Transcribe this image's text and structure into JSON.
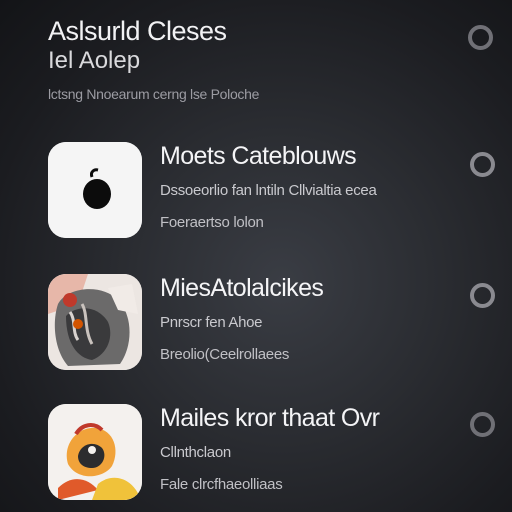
{
  "header": {
    "title": "Aslsurld Cleses",
    "subtitle": "Iel Aolep",
    "description": "lctsng Nnoearum cerng  lse  Poloche"
  },
  "items": [
    {
      "title": "Moets Cateblouws",
      "line1": "Dssoeorlio fan lntiln Cllvialtia ecea",
      "line2": "Foeraertso lolon",
      "icon": "apple-logo-icon"
    },
    {
      "title": "MiesAtolalcikes",
      "line1": "Pnrscr fen Ahoe",
      "line2": "Breolio(Ceelrollaees",
      "icon": "album-art-icon"
    },
    {
      "title": "Mailes kror thaat Ovr",
      "line1": "Cllnthclaon",
      "line2": "Fale clrcfhaeolliaas",
      "icon": "album-art-icon"
    }
  ],
  "colors": {
    "background": "#2a2c31",
    "radio": "#8a8a90",
    "title": "#f2f2f4",
    "secondary": "#9c9ca3"
  }
}
